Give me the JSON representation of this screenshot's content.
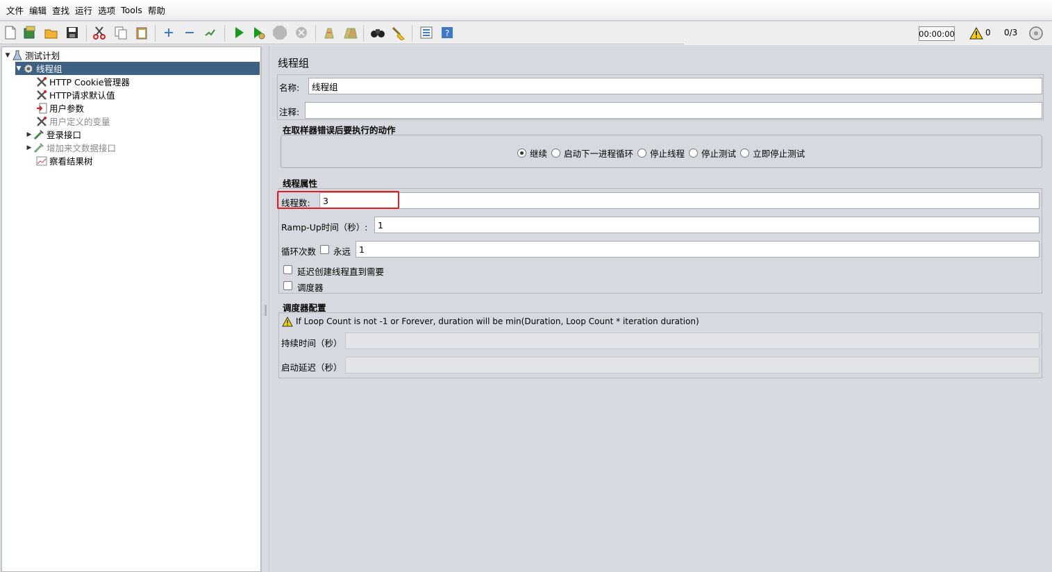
{
  "menu": [
    "文件",
    "编辑",
    "查找",
    "运行",
    "选项",
    "Tools",
    "帮助"
  ],
  "toolbar": {
    "timer": "00:00:00",
    "warning_count": "0",
    "threads": "0/3"
  },
  "tree": {
    "root": "测试计划",
    "selected": "线程组",
    "children": [
      "HTTP Cookie管理器",
      "HTTP请求默认值",
      "用户参数",
      "用户定义的变量",
      "登录接口",
      "增加来文数据接口",
      "察看结果树"
    ]
  },
  "panel": {
    "title": "线程组",
    "name_label": "名称:",
    "name_value": "线程组",
    "comment_label": "注释:",
    "comment_value": "",
    "error_section": "在取样器错误后要执行的动作",
    "error_actions": [
      "继续",
      "启动下一进程循环",
      "停止线程",
      "停止测试",
      "立即停止测试"
    ],
    "selected_action": "继续",
    "thread_section": "线程属性",
    "thread_count_label": "线程数:",
    "thread_count_value": "3",
    "rampup_label": "Ramp-Up时间（秒）:",
    "rampup_value": "1",
    "loop_label": "循环次数",
    "forever_label": "永远",
    "loop_value": "1",
    "delay_label": "延迟创建线程直到需要",
    "scheduler_label": "调度器",
    "scheduler_section": "调度器配置",
    "scheduler_warning": "If Loop Count is not -1 or Forever, duration will be min(Duration, Loop Count * iteration duration)",
    "duration_label": "持续时间（秒）",
    "startup_delay_label": "启动延迟（秒）"
  },
  "colors": {
    "selection": "#3d6185",
    "highlight_border": "#e02020",
    "run_green": "#1a9a1a"
  }
}
